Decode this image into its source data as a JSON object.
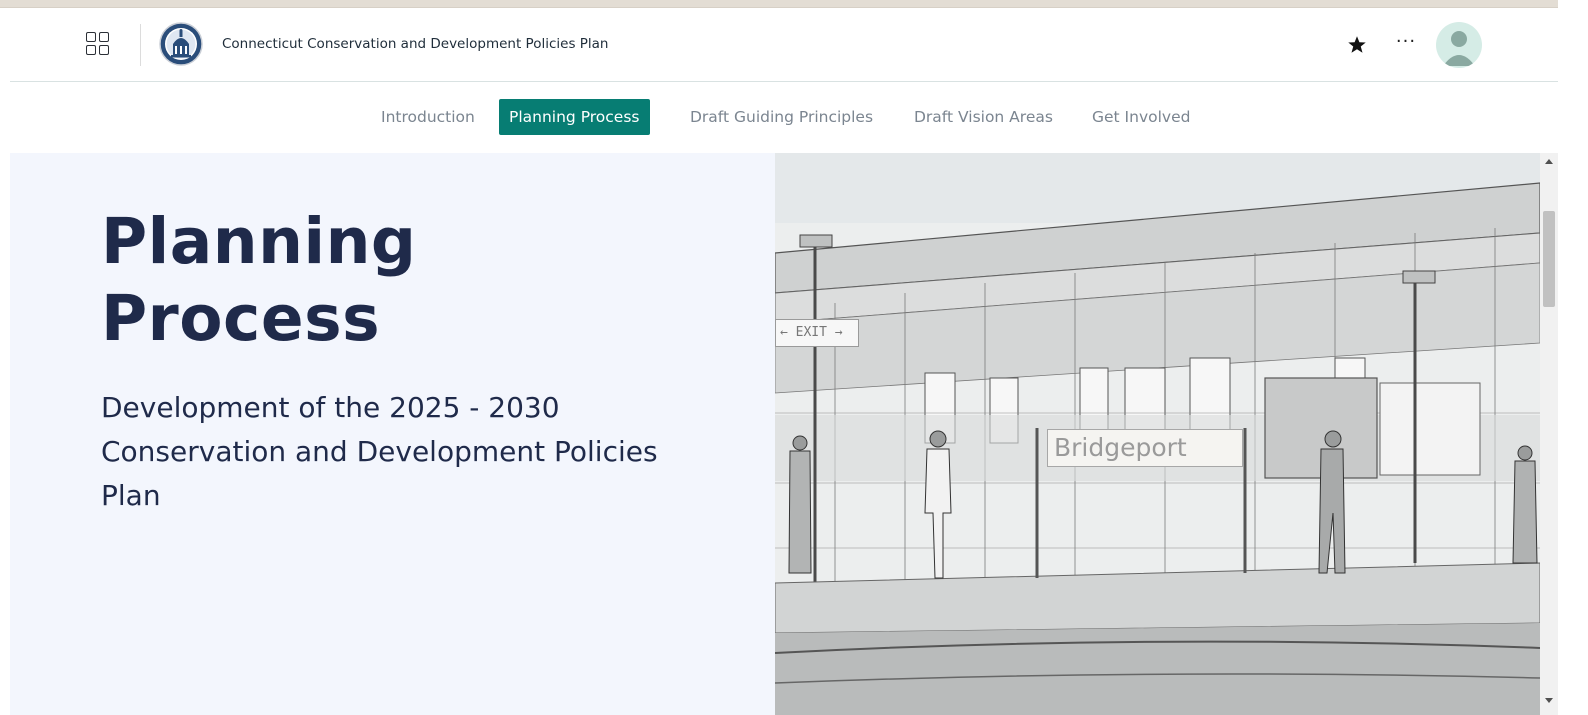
{
  "header": {
    "site_title": "Connecticut Conservation and Development Policies Plan",
    "icons": {
      "apps": "apps-grid-icon",
      "logo": "connecticut-seal-logo",
      "favorite": "star-icon",
      "more": "more-options-icon",
      "avatar": "user-avatar-icon"
    },
    "more_label": "···"
  },
  "nav": {
    "items": [
      {
        "label": "Introduction",
        "active": false
      },
      {
        "label": "Planning Process",
        "active": true
      },
      {
        "label": "Draft Guiding Principles",
        "active": false
      },
      {
        "label": "Draft Vision Areas",
        "active": false
      },
      {
        "label": "Get Involved",
        "active": false
      }
    ]
  },
  "hero": {
    "title_line1": "Planning",
    "title_line2": "Process",
    "subtitle_line1": "Development of the 2025 - 2030",
    "subtitle_line2": "Conservation and Development Policies",
    "subtitle_line3": "Plan",
    "image": {
      "station_sign": "Bridgeport",
      "exit_sign": "← EXIT  →"
    }
  },
  "colors": {
    "accent": "#077d73",
    "title_text": "#1f2a4a",
    "hero_background": "#f3f6fd",
    "nav_text": "#7b8590",
    "avatar_bg": "#d5ece6",
    "avatar_fg": "#8aa9a1"
  }
}
